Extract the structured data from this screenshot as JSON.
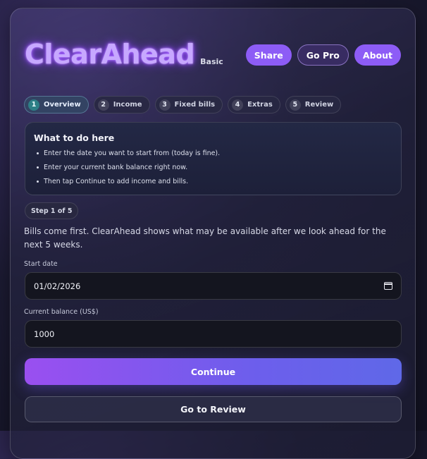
{
  "header": {
    "logo": "ClearAhead",
    "tier": "Basic",
    "buttons": {
      "share": "Share",
      "go_pro": "Go Pro",
      "about": "About"
    }
  },
  "steps": [
    {
      "num": "1",
      "label": "Overview"
    },
    {
      "num": "2",
      "label": "Income"
    },
    {
      "num": "3",
      "label": "Fixed bills"
    },
    {
      "num": "4",
      "label": "Extras"
    },
    {
      "num": "5",
      "label": "Review"
    }
  ],
  "help": {
    "title": "What to do here",
    "items": [
      "Enter the date you want to start from (today is fine).",
      "Enter your current bank balance right now.",
      "Then tap Continue to add income and bills."
    ]
  },
  "step_badge": "Step 1 of 5",
  "intro": "Bills come first. ClearAhead shows what may be available after we look ahead for the next 5 weeks.",
  "form": {
    "start_date_label": "Start date",
    "start_date_value": "01/02/2026",
    "balance_label": "Current balance (US$)",
    "balance_value": "1000"
  },
  "actions": {
    "continue": "Continue",
    "review": "Go to Review"
  },
  "colors": {
    "accent": "#8d5cf6",
    "active_step": "#2d7f86"
  }
}
